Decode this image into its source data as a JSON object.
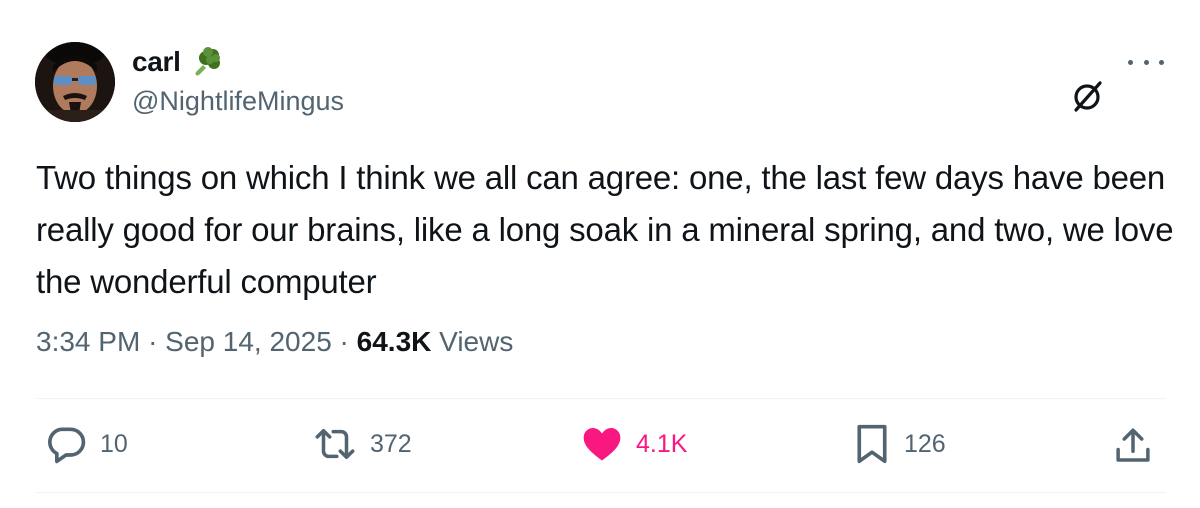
{
  "author": {
    "display_name": "carl",
    "handle": "@NightlifeMingus",
    "badge_emoji": "broccoli-icon",
    "avatar": "profile-photo"
  },
  "tweet": {
    "text": "Two things on which I think we all can agree: one, the last few days have been really good for our brains, like a long soak in a mineral spring, and two, we love the wonderful computer"
  },
  "meta": {
    "time": "3:34 PM",
    "separator": "·",
    "date": "Sep 14, 2025",
    "views_count": "64.3K",
    "views_label": "Views"
  },
  "actions": {
    "reply": {
      "icon": "reply-icon",
      "count": "10"
    },
    "retweet": {
      "icon": "retweet-icon",
      "count": "372"
    },
    "like": {
      "icon": "heart-icon",
      "count": "4.1K",
      "liked": true
    },
    "bookmark": {
      "icon": "bookmark-icon",
      "count": "126"
    },
    "share": {
      "icon": "share-icon"
    }
  },
  "header_icons": [
    "grok-icon",
    "more-icon"
  ],
  "colors": {
    "text_primary": "#0f1419",
    "text_secondary": "#536471",
    "like_pink": "#f91880",
    "divider": "#eff3f4"
  }
}
